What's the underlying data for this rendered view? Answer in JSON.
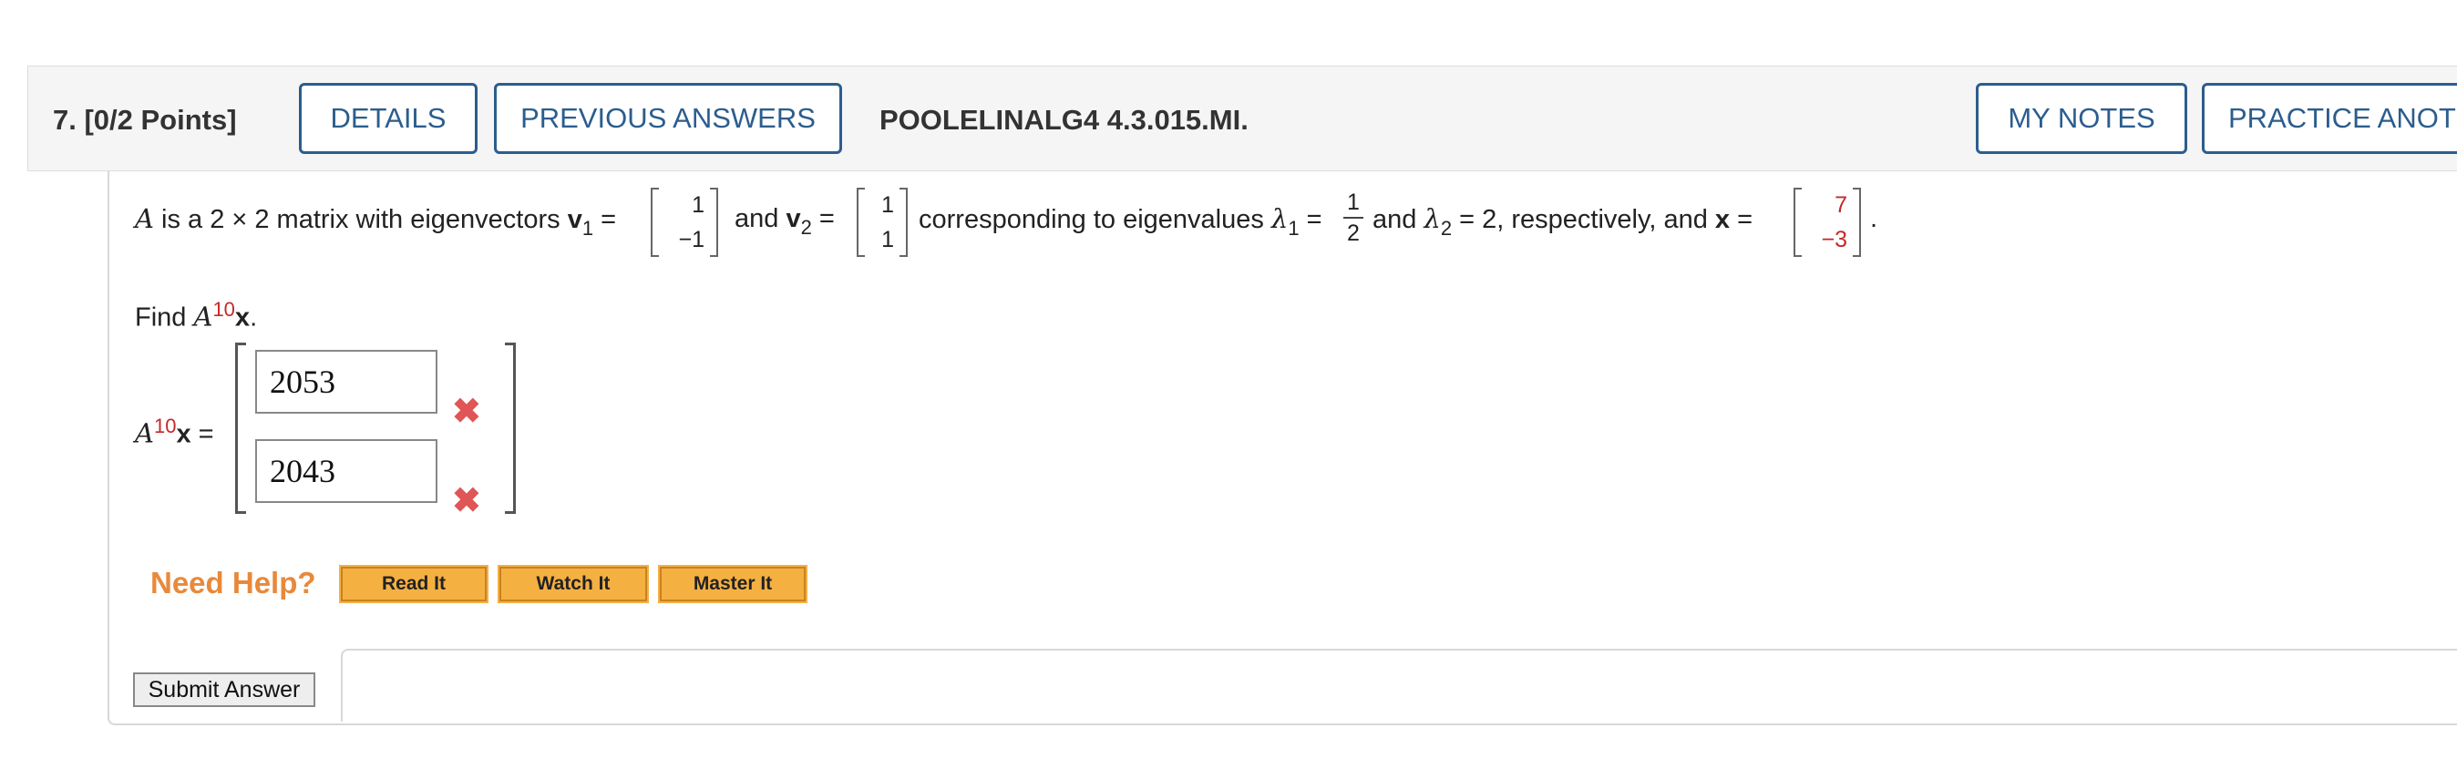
{
  "header": {
    "question_label": "7.  [0/2 Points]",
    "details_label": "DETAILS",
    "previous_answers_label": "PREVIOUS ANSWERS",
    "problem_code": "POOLELINALG4 4.3.015.MI.",
    "my_notes_label": "MY NOTES",
    "practice_label": "PRACTICE ANOTHER"
  },
  "problem": {
    "intro_a": "A",
    "intro_text": " is a 2 × 2 matrix with eigenvectors ",
    "v1_name": "v",
    "v1_sub": "1",
    "eq": " = ",
    "v1_top": "1",
    "v1_bottom": "−1",
    "and1": "and ",
    "v2_name": "v",
    "v2_sub": "2",
    "v2_top": "1",
    "v2_bottom": "1",
    "corr_text": "corresponding to eigenvalues ",
    "lambda": "λ",
    "l1_sub": "1",
    "l1_num": "1",
    "l1_den": "2",
    "and2": "and ",
    "l2_sub": "2",
    "l2_rest": " = 2, respectively, and ",
    "x_name": "x",
    "x_top": "7",
    "x_bottom": "−3",
    "period": ".",
    "find_text": "Find ",
    "find_a": "A",
    "find_exp": "10",
    "find_x": "x",
    "find_period": "."
  },
  "answer": {
    "label_a": "A",
    "label_exp": "10",
    "label_x": "x",
    "label_eq": " =",
    "entry_1": "2053",
    "entry_2": "2043",
    "status_icon": "x-mark-icon"
  },
  "help": {
    "title": "Need Help?",
    "read_it": "Read It",
    "watch_it": "Watch It",
    "master_it": "Master It"
  },
  "submit_label": "Submit Answer",
  "colors": {
    "accent_blue": "#2b5d8e",
    "need_help_orange": "#e8893a",
    "wrong_red": "#e05555",
    "value_red": "#c62828",
    "help_button": "#f5b042"
  }
}
